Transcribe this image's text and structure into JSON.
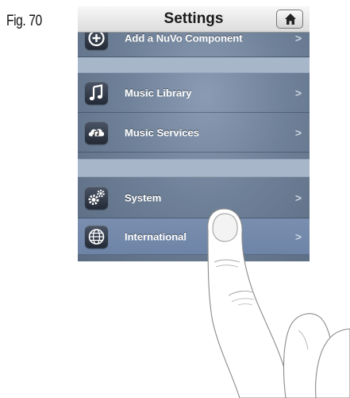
{
  "figure_label": "Fig. 70",
  "navbar": {
    "title": "Settings",
    "home_icon": "home-icon"
  },
  "menu": [
    {
      "label": "Add a NuVo Component",
      "icon": "plus-circle-icon",
      "chevron": ">"
    },
    {
      "label": "Music Library",
      "icon": "music-note-icon",
      "chevron": ">"
    },
    {
      "label": "Music Services",
      "icon": "cloud-music-icon",
      "chevron": ">"
    },
    {
      "label": "System",
      "icon": "gears-icon",
      "chevron": ">"
    },
    {
      "label": "International",
      "icon": "globe-icon",
      "chevron": ">",
      "pressed": true
    }
  ],
  "colors": {
    "list_background": "#6f8198",
    "separator": "#a7b6c9",
    "highlight": "#7a8fb0"
  },
  "overlay": "pointing-finger"
}
